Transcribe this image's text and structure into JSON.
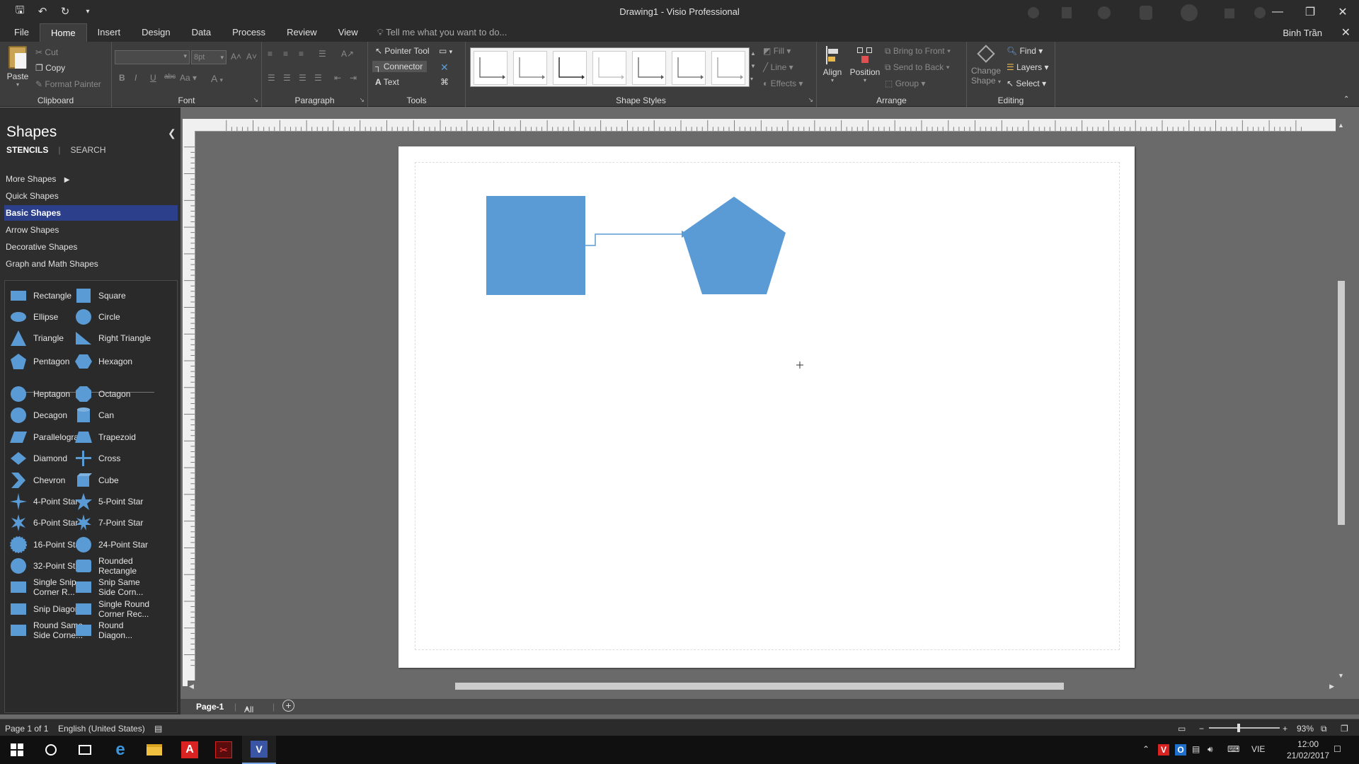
{
  "window": {
    "title": "Drawing1 - Visio Professional"
  },
  "tabs": [
    "File",
    "Home",
    "Insert",
    "Design",
    "Data",
    "Process",
    "Review",
    "View"
  ],
  "active_tab": "Home",
  "tell_me": "Tell me what you want to do...",
  "user": "Binh Trần",
  "ribbon": {
    "clipboard": {
      "paste": "Paste",
      "cut": "Cut",
      "copy": "Copy",
      "format_painter": "Format Painter",
      "label": "Clipboard"
    },
    "font": {
      "size": "8pt",
      "label": "Font"
    },
    "paragraph": {
      "label": "Paragraph"
    },
    "tools": {
      "pointer": "Pointer Tool",
      "connector": "Connector",
      "text": "Text",
      "label": "Tools"
    },
    "shape_styles": {
      "fill": "Fill",
      "line": "Line",
      "effects": "Effects",
      "label": "Shape Styles"
    },
    "arrange": {
      "align": "Align",
      "position": "Position",
      "bring_front": "Bring to Front",
      "send_back": "Send to Back",
      "group": "Group",
      "label": "Arrange"
    },
    "editing": {
      "change_shape_1": "Change",
      "change_shape_2": "Shape",
      "find": "Find",
      "layers": "Layers",
      "select": "Select",
      "label": "Editing"
    }
  },
  "shapes_panel": {
    "title": "Shapes",
    "tab_stencils": "STENCILS",
    "tab_search": "SEARCH",
    "nav": [
      "More Shapes",
      "Quick Shapes",
      "Basic Shapes",
      "Arrow Shapes",
      "Decorative Shapes",
      "Graph and Math Shapes"
    ],
    "selected_nav": "Basic Shapes",
    "stencil_items": [
      [
        "Rectangle",
        "Square"
      ],
      [
        "Ellipse",
        "Circle"
      ],
      [
        "Triangle",
        "Right Triangle"
      ],
      [
        "Pentagon",
        "Hexagon"
      ],
      [
        "Heptagon",
        "Octagon"
      ],
      [
        "Decagon",
        "Can"
      ],
      [
        "Parallelogra...",
        "Trapezoid"
      ],
      [
        "Diamond",
        "Cross"
      ],
      [
        "Chevron",
        "Cube"
      ],
      [
        "4-Point Star",
        "5-Point Star"
      ],
      [
        "6-Point Star",
        "7-Point Star"
      ],
      [
        "16-Point Star",
        "24-Point Star"
      ],
      [
        "32-Point Star",
        "Rounded Rectangle"
      ],
      [
        "Single Snip Corner R...",
        "Snip Same Side Corn..."
      ],
      [
        "Snip Diagon...",
        "Single Round Corner Rec..."
      ],
      [
        "Round Same Side Corne...",
        "Round Diagon..."
      ]
    ]
  },
  "page_tabs": {
    "page": "Page-1",
    "all": "All"
  },
  "status": {
    "page": "Page 1 of 1",
    "language": "English (United States)",
    "zoom": "93%"
  },
  "taskbar": {
    "lang": "VIE",
    "time": "12:00",
    "date": "21/02/2017"
  },
  "colors": {
    "shape_fill": "#5b9bd5",
    "accent_nav": "#2b3f8a"
  }
}
